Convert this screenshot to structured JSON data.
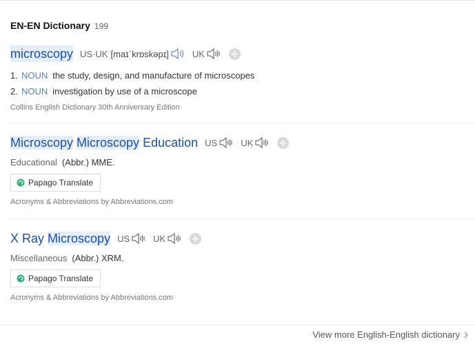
{
  "section": {
    "title": "EN-EN Dictionary",
    "count": "199"
  },
  "entries": [
    {
      "word": "microscopy",
      "pronunciation": {
        "label_us_uk": "US·UK",
        "phonetic": "[maɪˈkrɒskəpɪ]",
        "label_uk": "UK"
      },
      "definitions": [
        {
          "num": "1.",
          "pos": "NOUN",
          "text": "the study, design, and manufacture of microscopes"
        },
        {
          "num": "2.",
          "pos": "NOUN",
          "text": "investigation by use of a microscope"
        }
      ],
      "source": "Collins English Dictionary 30th Anniversary Edition"
    },
    {
      "words": [
        "Microscopy",
        "Microscopy",
        "Education"
      ],
      "label_us": "US",
      "label_uk": "UK",
      "category": "Educational",
      "abbr": "(Abbr.) MME.",
      "translate_label": "Papago Translate",
      "source": "Acronyms & Abbreviations by Abbreviations.com"
    },
    {
      "words": [
        "X Ray",
        "Microscopy"
      ],
      "label_us": "US",
      "label_uk": "UK",
      "category": "Miscellaneous",
      "abbr": "(Abbr.) XRM.",
      "translate_label": "Papago Translate",
      "source": "Acronyms & Abbreviations by Abbreviations.com"
    }
  ],
  "footer": {
    "more_link": "View more English-English dictionary"
  },
  "icons": {
    "speaker": "speaker-icon",
    "add": "plus-icon",
    "papago": "papago-icon",
    "chevron": "chevron-right-icon"
  },
  "colors": {
    "link_blue": "#1a4fad",
    "highlight": "#e4eefb",
    "pos_blue": "#5a7fb8"
  }
}
